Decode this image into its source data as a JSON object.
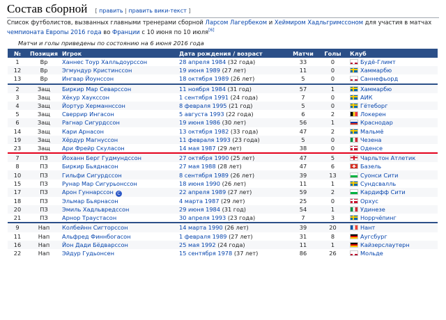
{
  "heading": {
    "title": "Состав сборной",
    "edit_open": "[",
    "edit_link": "править",
    "edit_sep": "|",
    "edit_wiki_link": "править вики-текст",
    "edit_close": "]"
  },
  "intro": {
    "t1": "Список футболистов, вызванных главными тренерами сборной ",
    "coach1": "Ларсом Лагербеком",
    "t2": " и ",
    "coach2": "Хеймиром Хадльгримссоном",
    "t3": " для участия в матчах ",
    "euro": "чемпионата Европы 2016 года",
    "t4": " во ",
    "france": "Франции",
    "t5": " с 10 июня по 10 июля",
    "ref": "[6]"
  },
  "note": "Матчи и голы приведены по состоянию на 6 июня 2016 года",
  "columns": [
    "№",
    "Позиция",
    "Игрок",
    "Дата рождения / возраст",
    "Матчи",
    "Голы",
    "Клуб"
  ],
  "players": [
    {
      "num": "1",
      "pos": "Вр",
      "name": "Ханнес Тоур Халльдоурссон",
      "dob": "28 апреля 1984",
      "age": "(32 года)",
      "caps": "33",
      "goals": "0",
      "club": "Будё-Глимт",
      "flag": "norway-flag",
      "group": "gk"
    },
    {
      "num": "12",
      "pos": "Вр",
      "name": "Эгмундур Кристинссон",
      "dob": "19 июня 1989",
      "age": "(27 лет)",
      "caps": "11",
      "goals": "0",
      "club": "Хаммарбю",
      "flag": "sweden-flag",
      "group": "gk"
    },
    {
      "num": "13",
      "pos": "Вр",
      "name": "Ингвар Йоунссон",
      "dob": "18 октября 1989",
      "age": "(26 лет)",
      "caps": "5",
      "goals": "0",
      "club": "Саннефьорд",
      "flag": "norway-flag",
      "group": "gk"
    },
    {
      "num": "2",
      "pos": "Защ",
      "name": "Биркир Мар Севарссон",
      "dob": "11 ноября 1984",
      "age": "(31 год)",
      "caps": "57",
      "goals": "1",
      "club": "Хаммарбю",
      "flag": "sweden-flag",
      "group": "df"
    },
    {
      "num": "3",
      "pos": "Защ",
      "name": "Хёкур Хаукссон",
      "dob": "1 сентября 1991",
      "age": "(24 года)",
      "caps": "7",
      "goals": "0",
      "club": "АИК",
      "flag": "sweden-flag",
      "group": "df"
    },
    {
      "num": "4",
      "pos": "Защ",
      "name": "Йортур Херманнссон",
      "dob": "8 февраля 1995",
      "age": "(21 год)",
      "caps": "5",
      "goals": "0",
      "club": "Гётеборг",
      "flag": "sweden-flag",
      "group": "df"
    },
    {
      "num": "5",
      "pos": "Защ",
      "name": "Сверрир Ингасон",
      "dob": "5 августа 1993",
      "age": "(22 года)",
      "caps": "6",
      "goals": "2",
      "club": "Локерен",
      "flag": "belgium-flag",
      "group": "df"
    },
    {
      "num": "6",
      "pos": "Защ",
      "name": "Рагнар Сигурдссон",
      "dob": "19 июня 1986",
      "age": "(30 лет)",
      "caps": "56",
      "goals": "1",
      "club": "Краснодар",
      "flag": "russia-flag",
      "group": "df"
    },
    {
      "num": "14",
      "pos": "Защ",
      "name": "Кари Арнасон",
      "dob": "13 октября 1982",
      "age": "(33 года)",
      "caps": "47",
      "goals": "2",
      "club": "Мальмё",
      "flag": "sweden-flag",
      "group": "df"
    },
    {
      "num": "19",
      "pos": "Защ",
      "name": "Хёрдур Магнуссон",
      "dob": "11 февраля 1993",
      "age": "(23 года)",
      "caps": "5",
      "goals": "0",
      "club": "Чезена",
      "flag": "italy-flag",
      "group": "df"
    },
    {
      "num": "23",
      "pos": "Защ",
      "name": "Ари Фрейр Скуласон",
      "dob": "14 мая 1987",
      "age": "(29 лет)",
      "caps": "38",
      "goals": "0",
      "club": "Оденсе",
      "flag": "denmark-flag",
      "group": "df"
    },
    {
      "num": "7",
      "pos": "ПЗ",
      "name": "Йоханн Берг Гудмундссон",
      "dob": "27 октября 1990",
      "age": "(25 лет)",
      "caps": "47",
      "goals": "5",
      "club": "Чарльтон Атлетик",
      "flag": "england-flag",
      "group": "mf"
    },
    {
      "num": "8",
      "pos": "ПЗ",
      "name": "Биркир Бьяднасон",
      "dob": "27 мая 1988",
      "age": "(28 лет)",
      "caps": "47",
      "goals": "6",
      "club": "Базель",
      "flag": "switzerland-flag",
      "group": "mf"
    },
    {
      "num": "10",
      "pos": "ПЗ",
      "name": "Гильфи Сигурдссон",
      "dob": "8 сентября 1989",
      "age": "(26 лет)",
      "caps": "39",
      "goals": "13",
      "club": "Суонси Сити",
      "flag": "wales-flag",
      "group": "mf"
    },
    {
      "num": "15",
      "pos": "ПЗ",
      "name": "Рунар Мар Сигурьонссон",
      "dob": "18 июня 1990",
      "age": "(26 лет)",
      "caps": "11",
      "goals": "1",
      "club": "Сундсвалль",
      "flag": "sweden-flag",
      "group": "mf"
    },
    {
      "num": "17",
      "pos": "ПЗ",
      "name": "Арон Гуннарссон",
      "dob": "22 апреля 1989",
      "age": "(27 лет)",
      "caps": "59",
      "goals": "2",
      "club": "Кардифф Сити",
      "flag": "wales-flag",
      "group": "mf",
      "captain": "С"
    },
    {
      "num": "18",
      "pos": "ПЗ",
      "name": "Эльмар Бьярнасон",
      "dob": "4 марта 1987",
      "age": "(29 лет)",
      "caps": "25",
      "goals": "0",
      "club": "Орхус",
      "flag": "denmark-flag",
      "group": "mf"
    },
    {
      "num": "20",
      "pos": "ПЗ",
      "name": "Эмиль Хадльвредссон",
      "dob": "29 июня 1984",
      "age": "(31 год)",
      "caps": "54",
      "goals": "1",
      "club": "Удинезе",
      "flag": "italy-flag",
      "group": "mf"
    },
    {
      "num": "21",
      "pos": "ПЗ",
      "name": "Арнор Траустасон",
      "dob": "30 апреля 1993",
      "age": "(23 года)",
      "caps": "7",
      "goals": "3",
      "club": "Норрчёпинг",
      "flag": "sweden-flag",
      "group": "mf"
    },
    {
      "num": "9",
      "pos": "Нап",
      "name": "Колбейнн Сигторссон",
      "dob": "14 марта 1990",
      "age": "(26 лет)",
      "caps": "39",
      "goals": "20",
      "club": "Нант",
      "flag": "france-flag",
      "group": "fw"
    },
    {
      "num": "11",
      "pos": "Нап",
      "name": "Альфред Финнбогасон",
      "dob": "1 февраля 1989",
      "age": "(27 лет)",
      "caps": "31",
      "goals": "8",
      "club": "Аугсбург",
      "flag": "germany-flag",
      "group": "fw"
    },
    {
      "num": "16",
      "pos": "Нап",
      "name": "Йон Дади Бёдварссон",
      "dob": "25 мая 1992",
      "age": "(24 года)",
      "caps": "11",
      "goals": "1",
      "club": "Кайзерслаутерн",
      "flag": "germany-flag",
      "group": "fw"
    },
    {
      "num": "22",
      "pos": "Нап",
      "name": "Эйдур Гудьонсен",
      "dob": "15 сентября 1978",
      "age": "(37 лет)",
      "caps": "86",
      "goals": "26",
      "club": "Мольде",
      "flag": "norway-flag",
      "group": "fw"
    }
  ],
  "colors": {
    "header_bg": "#2b4f88",
    "link": "#0645ad",
    "group_separator": "#2b4f88",
    "mf_separator": "#e3001b",
    "row_alt": "#f6f7f9"
  }
}
